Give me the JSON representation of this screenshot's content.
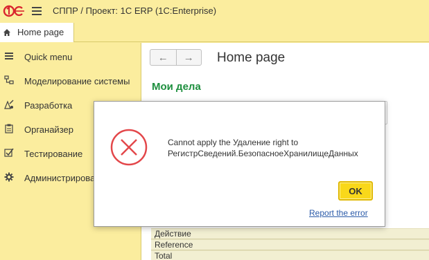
{
  "titlebar": {
    "logo_text": "1С",
    "title": "СППР / Проект: 1С ERP  (1С:Enterprise)"
  },
  "tabs": [
    {
      "label": "Home page",
      "icon": "home-icon"
    }
  ],
  "sidebar": {
    "items": [
      {
        "label": "Quick menu",
        "icon": "menu-icon"
      },
      {
        "label": "Моделирование системы",
        "icon": "system-model-icon"
      },
      {
        "label": "Разработка",
        "icon": "development-icon"
      },
      {
        "label": "Органайзер",
        "icon": "organizer-icon"
      },
      {
        "label": "Тестирование",
        "icon": "checkbox-icon"
      },
      {
        "label": "Администрирова",
        "icon": "gear-icon"
      }
    ]
  },
  "main": {
    "back_icon": "←",
    "forward_icon": "→",
    "page_title": "Home page",
    "section_title": "Мои дела",
    "table_rows": [
      "Действие",
      "Reference",
      "Total"
    ]
  },
  "dialog": {
    "message_line1": "Cannot apply the Удаление right to",
    "message_line2": "РегистрСведений.БезопасноеХранилищеДанных",
    "ok_label": "OK",
    "report_label": "Report the error",
    "icon": "error-icon"
  },
  "colors": {
    "background": "#fbed9e",
    "accent_green": "#1d8f3e",
    "error_red": "#e3474a",
    "ok_yellow": "#f9d81a",
    "link_blue": "#2a5aa8"
  }
}
